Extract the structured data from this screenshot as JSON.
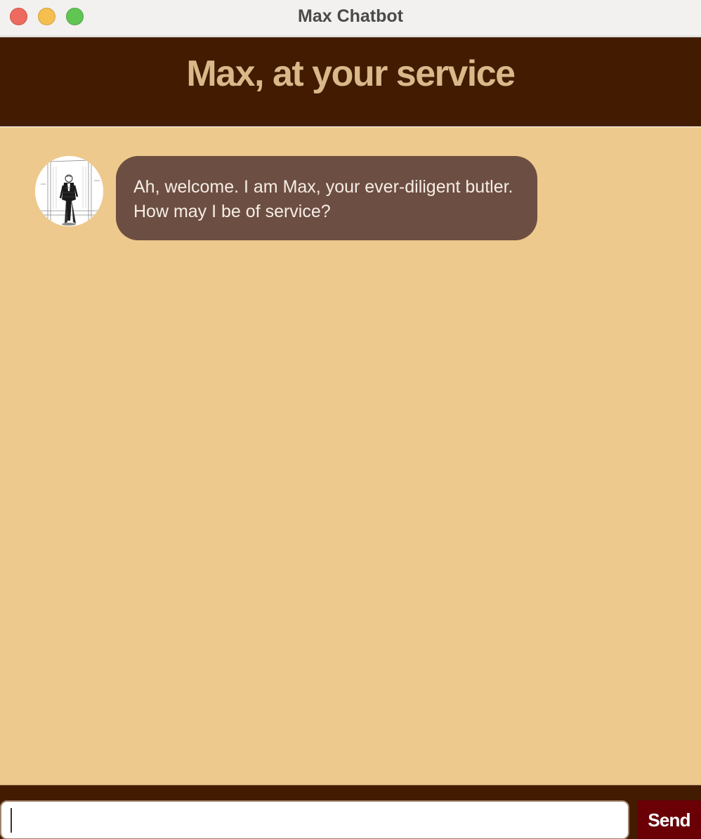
{
  "window": {
    "title": "Max Chatbot",
    "controls": [
      "close",
      "minimize",
      "maximize"
    ]
  },
  "header": {
    "title": "Max, at your service"
  },
  "messages": [
    {
      "sender": "bot",
      "avatar": "butler-portrait-illustration",
      "text": "Ah, welcome. I am Max, your ever-diligent butler. How may I be of service?"
    }
  ],
  "footer": {
    "input_value": "",
    "send_label": "Send"
  },
  "colors": {
    "header_bg": "#421b00",
    "header_text": "#d9b88a",
    "chat_bg": "#eec98d",
    "bot_bubble": "#6d4e42",
    "send_button": "#6a0006"
  }
}
